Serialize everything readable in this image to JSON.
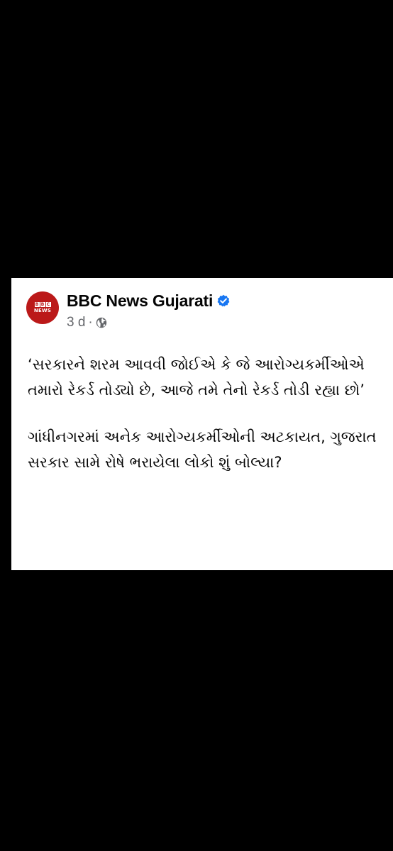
{
  "post": {
    "page_name": "BBC News Gujarati",
    "avatar": {
      "letters": [
        "B",
        "B",
        "C"
      ],
      "word": "NEWS",
      "color": "#bb1919"
    },
    "time": "3 d",
    "separator": "·",
    "audience_icon": "globe-icon",
    "verified_icon": "verified-badge-icon",
    "verified_color": "#1877f2",
    "paragraphs": [
      "‘સરકારને શરમ આવવી જોઈએ કે જે આરોગ્યકર્મીઓએ તમારો રેકર્ડ તોડ્યો છે, આજે તમે તેનો રેકર્ડ તોડી રહ્યા છો’",
      "ગાંધીનગરમાં અનેક આરોગ્યકર્મીઓની અટકાયત, ગુજરાત સરકાર સામે રોષે ભરાયેલા લોકો શું બોલ્યા?"
    ]
  }
}
